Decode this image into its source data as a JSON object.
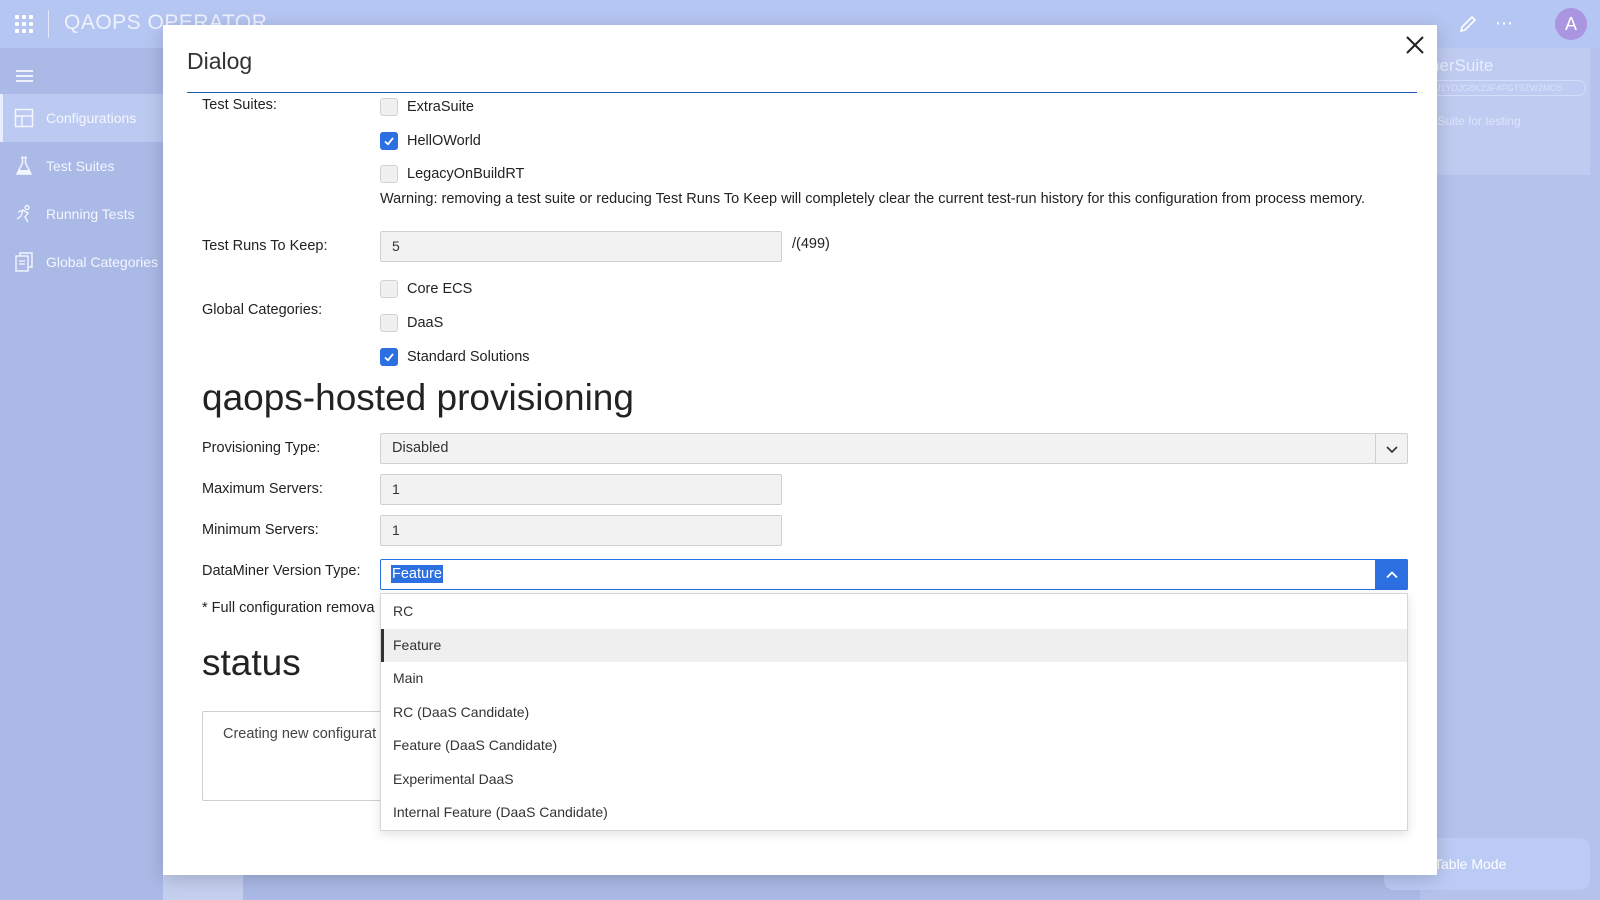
{
  "app": {
    "title": "QAOPS OPERATOR",
    "avatar_initial": "A"
  },
  "sidebar": {
    "items": [
      {
        "label": "Configurations",
        "icon": "grid-icon",
        "active": true
      },
      {
        "label": "Test Suites",
        "icon": "flask-icon",
        "active": false
      },
      {
        "label": "Running Tests",
        "icon": "running-icon",
        "active": false
      },
      {
        "label": "Global Categories",
        "icon": "document-icon",
        "active": false
      }
    ]
  },
  "right_panel": {
    "card_title": "nerSuite",
    "card_id": "6J1YDJG8K23F4FGT9ZW2MDS",
    "card_description": "r Suite for testing",
    "table_mode_label": "Table Mode"
  },
  "dialog": {
    "title": "Dialog",
    "test_suites": {
      "label": "Test Suites:",
      "options": [
        {
          "label": "ExtraSuite",
          "checked": false
        },
        {
          "label": "HellOWorld",
          "checked": true
        },
        {
          "label": "LegacyOnBuildRT",
          "checked": false
        }
      ]
    },
    "warning": "Warning: removing a test suite or reducing Test Runs To Keep will completely clear the current test-run history for this configuration from process memory.",
    "test_runs_to_keep": {
      "label": "Test Runs To Keep:",
      "value": "5",
      "max_suffix": "/(499)"
    },
    "global_categories": {
      "label": "Global Categories:",
      "options": [
        {
          "label": "Core ECS",
          "checked": false
        },
        {
          "label": "DaaS",
          "checked": false
        },
        {
          "label": "Standard Solutions",
          "checked": true
        }
      ]
    },
    "provisioning": {
      "heading": "qaops-hosted provisioning",
      "type_label": "Provisioning Type:",
      "type_value": "Disabled",
      "max_servers_label": "Maximum Servers:",
      "max_servers_value": "1",
      "min_servers_label": "Minimum Servers:",
      "min_servers_value": "1",
      "version_type_label": "DataMiner Version Type:",
      "version_type_value": "Feature",
      "full_removal_note": "* Full configuration remova"
    },
    "version_type_options": [
      {
        "label": "RC",
        "selected": false
      },
      {
        "label": "Feature",
        "selected": true
      },
      {
        "label": "Main",
        "selected": false
      },
      {
        "label": "RC (DaaS Candidate)",
        "selected": false
      },
      {
        "label": "Feature (DaaS Candidate)",
        "selected": false
      },
      {
        "label": "Experimental DaaS",
        "selected": false
      },
      {
        "label": "Internal Feature (DaaS Candidate)",
        "selected": false
      }
    ],
    "status": {
      "heading": "status",
      "text": "Creating new configurat"
    }
  },
  "colors": {
    "accent": "#2b6fe0",
    "backdrop": "#aab9e6",
    "title_rule": "#1f5bb5"
  }
}
